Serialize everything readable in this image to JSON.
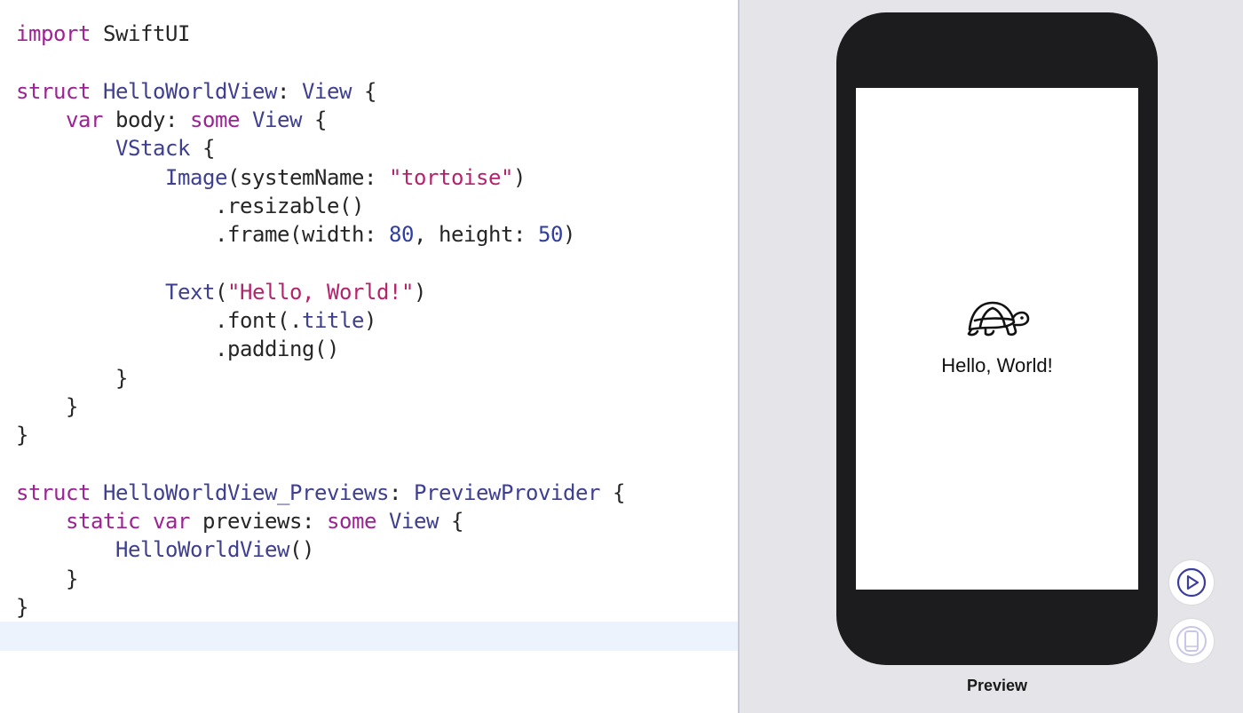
{
  "editor": {
    "lines": [
      [
        {
          "t": "kw",
          "v": "import"
        },
        {
          "t": "plain",
          "v": " SwiftUI"
        }
      ],
      [],
      [
        {
          "t": "kw",
          "v": "struct"
        },
        {
          "t": "plain",
          "v": " "
        },
        {
          "t": "type",
          "v": "HelloWorldView"
        },
        {
          "t": "plain",
          "v": ": "
        },
        {
          "t": "type",
          "v": "View"
        },
        {
          "t": "plain",
          "v": " {"
        }
      ],
      [
        {
          "t": "plain",
          "v": "    "
        },
        {
          "t": "kw",
          "v": "var"
        },
        {
          "t": "plain",
          "v": " body: "
        },
        {
          "t": "kw",
          "v": "some"
        },
        {
          "t": "plain",
          "v": " "
        },
        {
          "t": "type",
          "v": "View"
        },
        {
          "t": "plain",
          "v": " {"
        }
      ],
      [
        {
          "t": "plain",
          "v": "        "
        },
        {
          "t": "type",
          "v": "VStack"
        },
        {
          "t": "plain",
          "v": " {"
        }
      ],
      [
        {
          "t": "plain",
          "v": "            "
        },
        {
          "t": "type",
          "v": "Image"
        },
        {
          "t": "plain",
          "v": "(systemName: "
        },
        {
          "t": "str",
          "v": "\"tortoise\""
        },
        {
          "t": "plain",
          "v": ")"
        }
      ],
      [
        {
          "t": "plain",
          "v": "                .resizable()"
        }
      ],
      [
        {
          "t": "plain",
          "v": "                .frame(width: "
        },
        {
          "t": "num",
          "v": "80"
        },
        {
          "t": "plain",
          "v": ", height: "
        },
        {
          "t": "num",
          "v": "50"
        },
        {
          "t": "plain",
          "v": ")"
        }
      ],
      [],
      [
        {
          "t": "plain",
          "v": "            "
        },
        {
          "t": "type",
          "v": "Text"
        },
        {
          "t": "plain",
          "v": "("
        },
        {
          "t": "str",
          "v": "\"Hello, World!\""
        },
        {
          "t": "plain",
          "v": ")"
        }
      ],
      [
        {
          "t": "plain",
          "v": "                .font(."
        },
        {
          "t": "type",
          "v": "title"
        },
        {
          "t": "plain",
          "v": ")"
        }
      ],
      [
        {
          "t": "plain",
          "v": "                .padding()"
        }
      ],
      [
        {
          "t": "plain",
          "v": "        }"
        }
      ],
      [
        {
          "t": "plain",
          "v": "    }"
        }
      ],
      [
        {
          "t": "plain",
          "v": "}"
        }
      ],
      [],
      [
        {
          "t": "kw",
          "v": "struct"
        },
        {
          "t": "plain",
          "v": " "
        },
        {
          "t": "type",
          "v": "HelloWorldView_Previews"
        },
        {
          "t": "plain",
          "v": ": "
        },
        {
          "t": "type",
          "v": "PreviewProvider"
        },
        {
          "t": "plain",
          "v": " {"
        }
      ],
      [
        {
          "t": "plain",
          "v": "    "
        },
        {
          "t": "kw",
          "v": "static"
        },
        {
          "t": "plain",
          "v": " "
        },
        {
          "t": "kw",
          "v": "var"
        },
        {
          "t": "plain",
          "v": " previews: "
        },
        {
          "t": "kw",
          "v": "some"
        },
        {
          "t": "plain",
          "v": " "
        },
        {
          "t": "type",
          "v": "View"
        },
        {
          "t": "plain",
          "v": " {"
        }
      ],
      [
        {
          "t": "plain",
          "v": "        "
        },
        {
          "t": "type",
          "v": "HelloWorldView"
        },
        {
          "t": "plain",
          "v": "()"
        }
      ],
      [
        {
          "t": "plain",
          "v": "    }"
        }
      ],
      [
        {
          "t": "plain",
          "v": "}"
        }
      ],
      []
    ],
    "current_line": 22
  },
  "preview": {
    "screen_text": "Hello, World!",
    "image_icon": "tortoise-icon",
    "label": "Preview",
    "buttons": [
      {
        "name": "live-preview-button",
        "icon": "play-icon"
      },
      {
        "name": "device-settings-button",
        "icon": "device-icon"
      }
    ]
  },
  "colors": {
    "keyword": "#9b2393",
    "string": "#b4246c",
    "type": "#3e3f8f",
    "number": "#2f3ea0",
    "plain": "#262626",
    "current_line": "#ecf3fd",
    "canvas": "#e4e4e9",
    "device": "#1c1c1e",
    "button_accent": "#3b3d9c"
  }
}
